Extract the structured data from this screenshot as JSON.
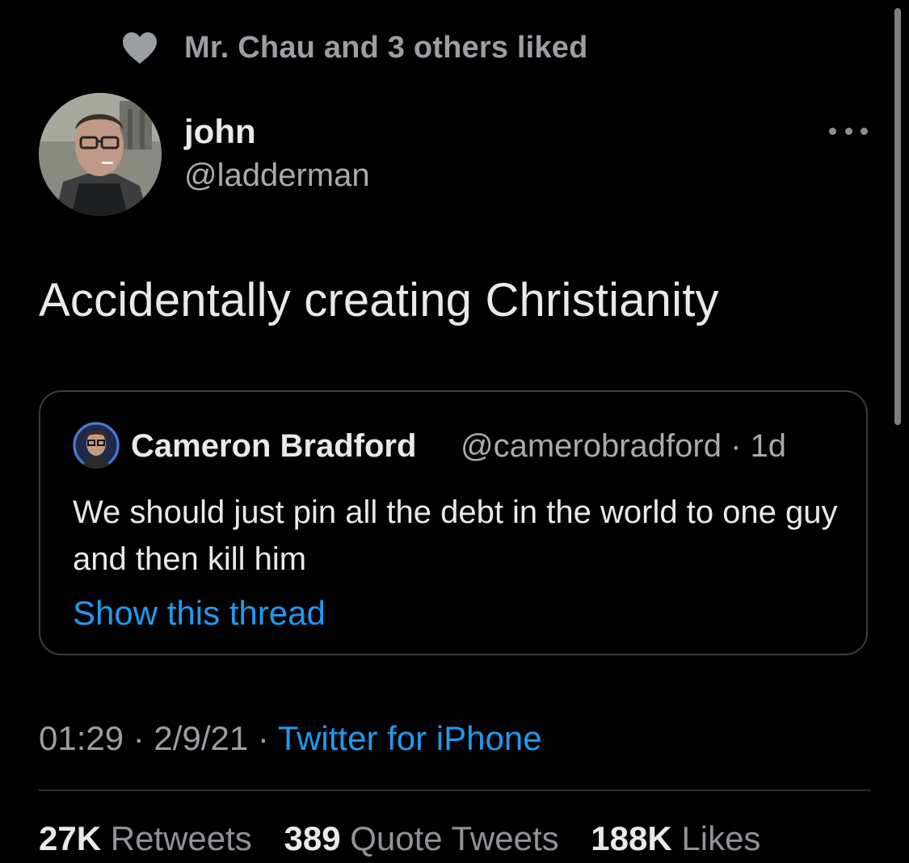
{
  "social_context": {
    "text": "Mr. Chau and 3 others liked",
    "icon": "heart-icon"
  },
  "author": {
    "display_name": "john",
    "handle": "@ladderman"
  },
  "tweet": {
    "text": "Accidentally creating Christianity"
  },
  "quoted_tweet": {
    "author_name": "Cameron Bradford",
    "handle_and_time": "@camerobradford · 1d",
    "text": "We should just pin all the debt in the world to one guy and then kill him",
    "show_thread_label": "Show this thread"
  },
  "metadata": {
    "time_and_date": "01:29 · 2/9/21 · ",
    "source": "Twitter for iPhone"
  },
  "stats": {
    "retweets_count": "27K",
    "retweets_label": "Retweets",
    "quotes_count": "389",
    "quotes_label": "Quote Tweets",
    "likes_count": "188K",
    "likes_label": "Likes"
  },
  "colors": {
    "background": "#000000",
    "link": "#1d9bf0",
    "secondary_text": "#9b9ea3",
    "primary_text": "#e7e9ea"
  }
}
